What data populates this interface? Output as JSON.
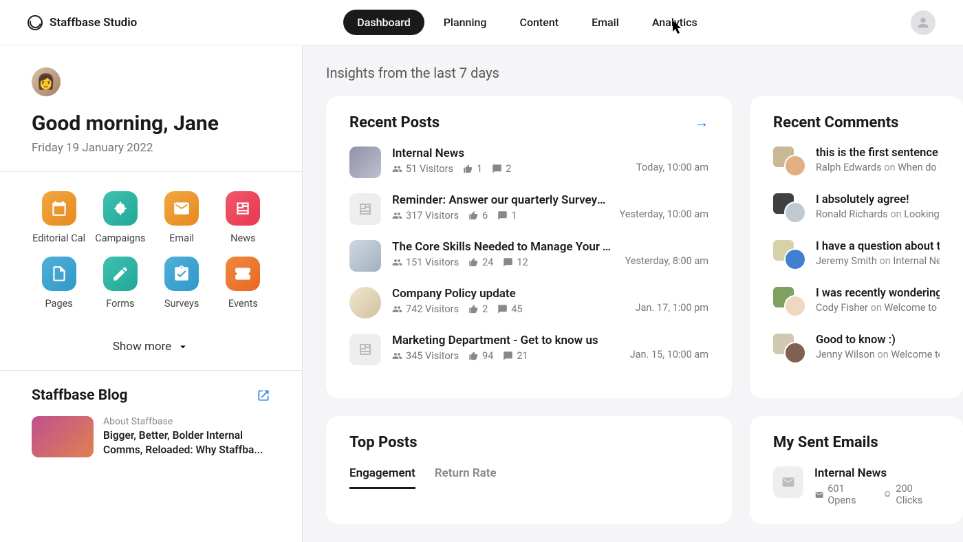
{
  "brand": "Staffbase Studio",
  "nav": [
    {
      "label": "Dashboard",
      "active": true
    },
    {
      "label": "Planning",
      "active": false
    },
    {
      "label": "Content",
      "active": false
    },
    {
      "label": "Email",
      "active": false
    },
    {
      "label": "Analytics",
      "active": false
    }
  ],
  "sidebar": {
    "greeting": "Good morning, Jane",
    "date": "Friday 19 January 2022",
    "quicklinks": [
      {
        "label": "Editorial Cal",
        "color": "linear-gradient(135deg,#f0a840,#e88820)",
        "icon": "calendar"
      },
      {
        "label": "Campaigns",
        "color": "linear-gradient(135deg,#40c0b0,#20a898)",
        "icon": "megaphone"
      },
      {
        "label": "Email",
        "color": "linear-gradient(135deg,#f0a840,#e88820)",
        "icon": "mail"
      },
      {
        "label": "News",
        "color": "linear-gradient(135deg,#f05868,#e83850)",
        "icon": "news"
      },
      {
        "label": "Pages",
        "color": "linear-gradient(135deg,#50b0d8,#3098c8)",
        "icon": "page"
      },
      {
        "label": "Forms",
        "color": "linear-gradient(135deg,#40c0b0,#20a898)",
        "icon": "form"
      },
      {
        "label": "Surveys",
        "color": "linear-gradient(135deg,#50b0d8,#3098c8)",
        "icon": "survey"
      },
      {
        "label": "Events",
        "color": "linear-gradient(135deg,#f08840,#e86820)",
        "icon": "ticket"
      }
    ],
    "show_more": "Show more",
    "blog": {
      "title": "Staffbase Blog",
      "category": "About Staffbase",
      "headline": "Bigger, Better, Bolder Internal Comms, Reloaded: Why Staffba..."
    }
  },
  "insights_title": "Insights from the last 7 days",
  "recent_posts": {
    "title": "Recent Posts",
    "items": [
      {
        "title": "Internal News",
        "visitors": "51 Visitors",
        "likes": "1",
        "comments": "2",
        "time": "Today, 10:00 am",
        "thumb": "photo1"
      },
      {
        "title": "Reminder: Answer our quarterly Survey until tomorrow!",
        "visitors": "317 Visitors",
        "likes": "6",
        "comments": "1",
        "time": "Yesterday, 10:00 am",
        "thumb": "placeholder"
      },
      {
        "title": "The Core Skills Needed to Manage Your Team ...",
        "visitors": "151 Visitors",
        "likes": "24",
        "comments": "12",
        "time": "Yesterday, 8:00 am",
        "thumb": "photo2"
      },
      {
        "title": "Company Policy update",
        "visitors": "742 Visitors",
        "likes": "2",
        "comments": "45",
        "time": "Jan. 17, 1:00 pm",
        "thumb": "avatar"
      },
      {
        "title": "Marketing Department - Get to know us",
        "visitors": "345 Visitors",
        "likes": "94",
        "comments": "21",
        "time": "Jan. 15, 10:00 am",
        "thumb": "placeholder"
      }
    ]
  },
  "recent_comments": {
    "title": "Recent Comments",
    "items": [
      {
        "text": "this is the first sentence of t",
        "author": "Ralph Edwards",
        "post": "When do you",
        "back": "#c8b898",
        "front": "#e0b080"
      },
      {
        "text": "I absolutely agree!",
        "author": "Ronald Richards",
        "post": "Looking tow",
        "back": "#404040",
        "front": "#c0c8d0"
      },
      {
        "text": "I have a question about this",
        "author": "Jeremy Smith",
        "post": "Internal News",
        "back": "#d8d0a8",
        "front": "#4080d0"
      },
      {
        "text": "I was recently wondering ab",
        "author": "Cody Fisher",
        "post": "Welcome to you",
        "back": "#80a060",
        "front": "#f0d8c0"
      },
      {
        "text": "Good to know :)",
        "author": "Jenny Wilson",
        "post": "Welcome to yo",
        "back": "#d0c8b0",
        "front": "#806050"
      }
    ]
  },
  "top_posts": {
    "title": "Top Posts",
    "tabs": [
      {
        "label": "Engagement",
        "active": true
      },
      {
        "label": "Return Rate",
        "active": false
      }
    ]
  },
  "sent_emails": {
    "title": "My Sent Emails",
    "items": [
      {
        "title": "Internal News",
        "opens": "601 Opens",
        "clicks": "200 Clicks"
      }
    ]
  },
  "on_label": "on"
}
